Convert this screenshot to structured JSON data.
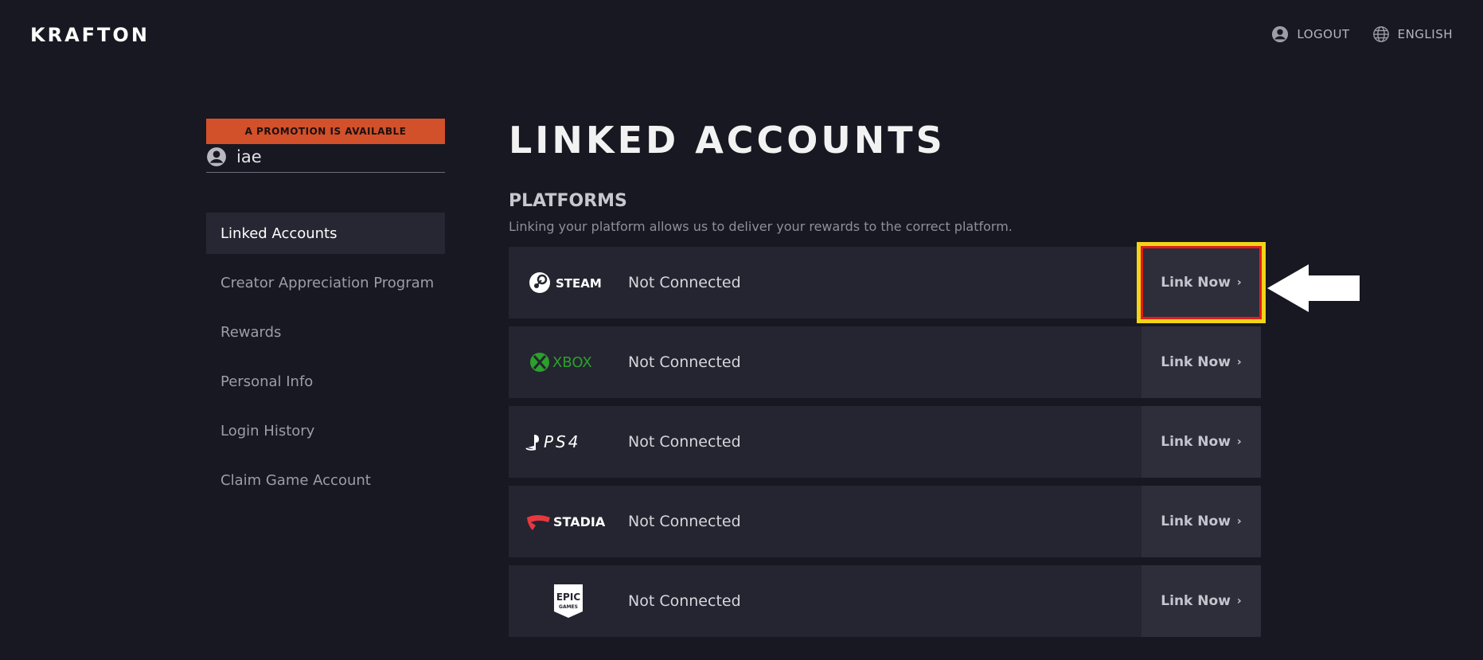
{
  "header": {
    "logo": "KRAFTON",
    "logout_label": "LOGOUT",
    "language_label": "ENGLISH"
  },
  "sidebar": {
    "promo_text": "A PROMOTION IS AVAILABLE",
    "username": "iae",
    "items": [
      {
        "label": "Linked Accounts",
        "active": true
      },
      {
        "label": "Creator Appreciation Program"
      },
      {
        "label": "Rewards"
      },
      {
        "label": "Personal Info"
      },
      {
        "label": "Login History"
      },
      {
        "label": "Claim Game Account"
      }
    ]
  },
  "main": {
    "title": "LINKED ACCOUNTS",
    "section_title": "PLATFORMS",
    "section_desc": "Linking your platform allows us to deliver your rewards to the correct platform.",
    "platforms": [
      {
        "name": "STEAM",
        "status": "Not Connected",
        "button": "Link Now"
      },
      {
        "name": "XBOX",
        "status": "Not Connected",
        "button": "Link Now"
      },
      {
        "name": "PS4",
        "status": "Not Connected",
        "button": "Link Now"
      },
      {
        "name": "STADIA",
        "status": "Not Connected",
        "button": "Link Now"
      },
      {
        "name": "EPIC GAMES",
        "status": "Not Connected",
        "button": "Link Now"
      }
    ]
  },
  "colors": {
    "background": "#171821",
    "promo": "#d2502a",
    "row": "#242530",
    "xbox_green": "#2ca02c",
    "stadia_red": "#e8383f",
    "highlight_red": "#e21b1b",
    "highlight_yellow": "#f1d518"
  }
}
